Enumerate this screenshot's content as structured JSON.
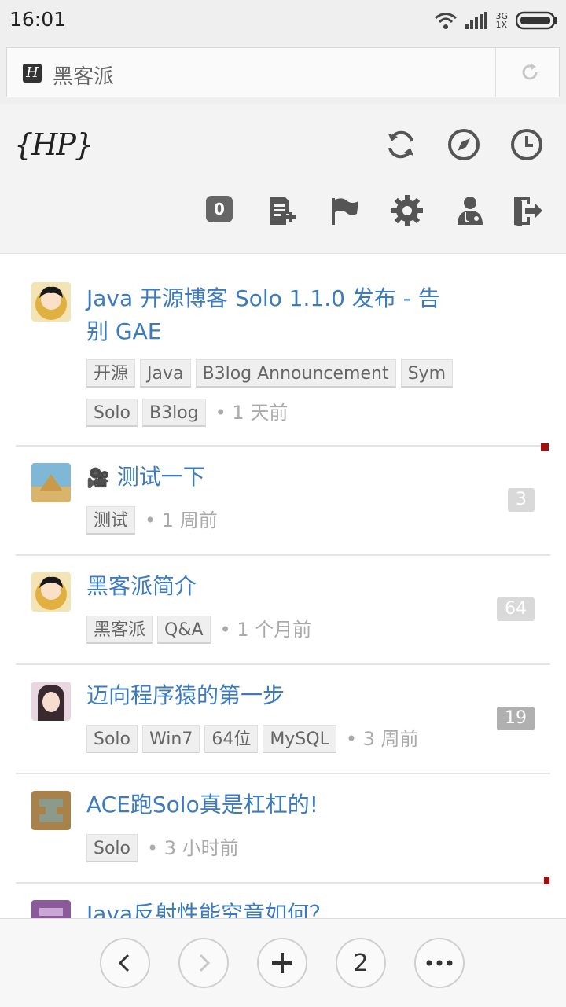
{
  "status_bar": {
    "time": "16:01",
    "network_top": "3G",
    "network_bottom": "1X",
    "icons": [
      "wifi-icon",
      "signal-icon",
      "battery-icon"
    ]
  },
  "address_bar": {
    "favicon_letter": "H",
    "title": "黑客派",
    "reload_icon": "reload-icon"
  },
  "header": {
    "logo_text": "{HP}",
    "notification_count": "0",
    "icons_row1": [
      "refresh-icon",
      "compass-icon",
      "clock-icon"
    ],
    "icons_row2": [
      "new-post-icon",
      "flag-icon",
      "gear-icon",
      "user-icon",
      "logout-icon"
    ]
  },
  "articles": [
    {
      "title_line1": "Java 开源博客 Solo 1.1.0 发布 - 告",
      "title_line2": "别 GAE",
      "tags": [
        "开源",
        "Java",
        "B3log Announcement",
        "Sym",
        "Solo",
        "B3log"
      ],
      "time": "• 1 天前",
      "comment_count": "",
      "avatar": "anime-avatar-1"
    },
    {
      "title": "测试一下",
      "has_video_icon": true,
      "tags": [
        "测试"
      ],
      "time": "• 1 周前",
      "comment_count": "3",
      "avatar": "pyramid-avatar"
    },
    {
      "title": "黑客派简介",
      "tags": [
        "黑客派",
        "Q&A"
      ],
      "time": "• 1 个月前",
      "comment_count": "64",
      "avatar": "anime-avatar-1"
    },
    {
      "title": "迈向程序猿的第一步",
      "tags": [
        "Solo",
        "Win7",
        "64位",
        "MySQL"
      ],
      "time": "• 3 周前",
      "comment_count": "19",
      "avatar": "anime-avatar-2"
    },
    {
      "title": "ACE跑Solo真是杠杠的!",
      "tags": [
        "Solo"
      ],
      "time": "• 3 小时前",
      "comment_count": "",
      "avatar": "pixel-avatar-1"
    },
    {
      "title": "Java反射性能究竟如何？",
      "tags": [],
      "time": "",
      "comment_count": "",
      "avatar": "pixel-avatar-2"
    }
  ],
  "colors": {
    "link": "#3b7bbf",
    "count_light": "#d9d9d9",
    "count_dark": "#b0b0b0",
    "unread_marker": "#a01010"
  },
  "bottom_bar": {
    "back": "‹",
    "forward": "›",
    "add": "+",
    "tabs": "2",
    "more": "•••"
  }
}
